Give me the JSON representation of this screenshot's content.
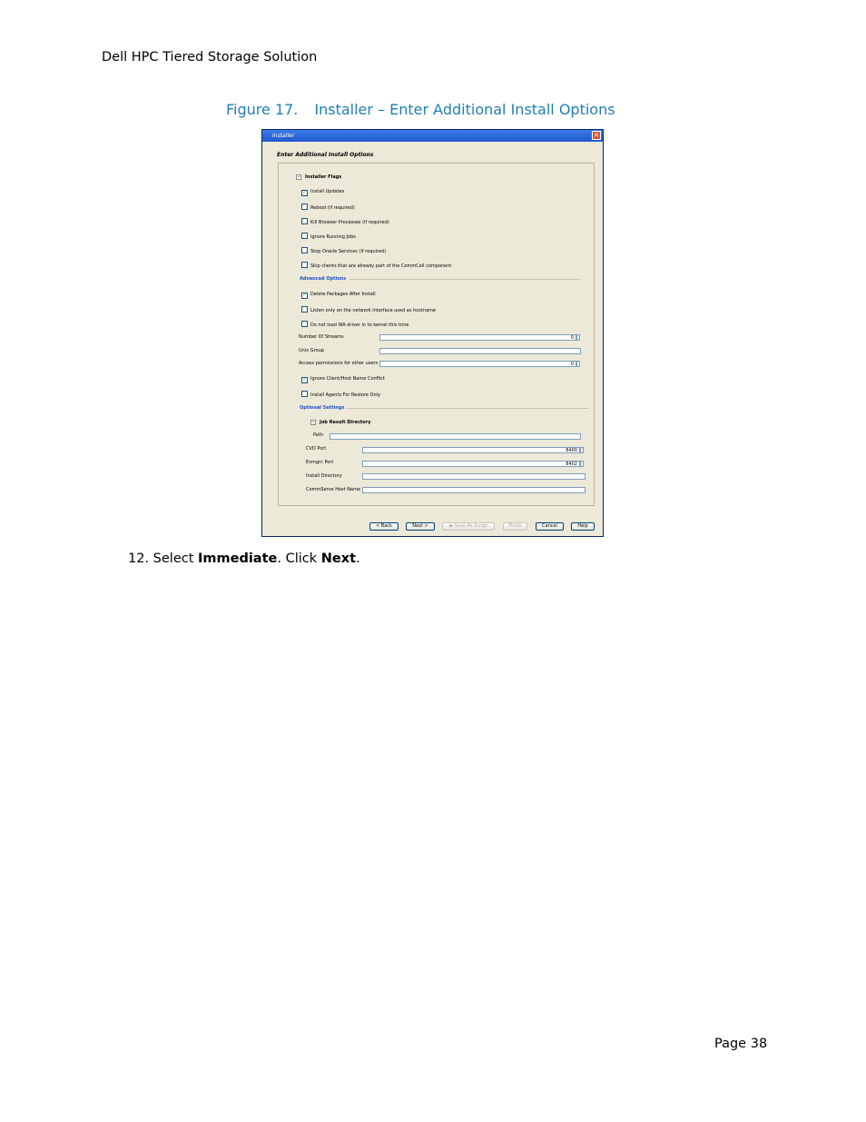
{
  "header": {
    "title": "Dell HPC Tiered Storage Solution"
  },
  "caption": {
    "number": "Figure 17.",
    "text": "Installer – Enter Additional Install Options"
  },
  "dialog": {
    "title": "Installer",
    "heading": "Enter Additional Install Options",
    "installer_flags": {
      "label": "Installer Flags",
      "items": [
        {
          "label": "Install Updates",
          "checked": true
        },
        {
          "label": "Reboot (if required)",
          "checked": false
        },
        {
          "label": "Kill Browser Processes (if required)",
          "checked": false
        },
        {
          "label": "Ignore Running Jobs",
          "checked": false
        },
        {
          "label": "Stop Oracle Services (if required)",
          "checked": false
        },
        {
          "label": "Skip clients that are already part of the CommCell component",
          "checked": false
        }
      ]
    },
    "advanced_options": {
      "label": "Advanced Options",
      "items": [
        {
          "label": "Delete Packages After Install",
          "checked": true
        },
        {
          "label": "Listen only on the network interface used as hostname",
          "checked": false
        },
        {
          "label": "Do not load WA driver in to kernel this time",
          "checked": false
        }
      ],
      "number_of_streams": {
        "label": "Number Of Streams",
        "value": "0"
      },
      "unix_group": {
        "label": "Unix Group",
        "value": ""
      },
      "access_permissions": {
        "label": "Access permissions for other users",
        "value": "0"
      },
      "items2": [
        {
          "label": "Ignore Client/Host Name Conflict",
          "checked": true
        },
        {
          "label": "Install Agents For Restore Only",
          "checked": false
        }
      ]
    },
    "optional_settings": {
      "label": "Optional Settings",
      "job_result_directory": {
        "label": "Job Result Directory",
        "path_label": "Path",
        "path_value": ""
      },
      "cvd_port": {
        "label": "CVD Port",
        "value": "8400"
      },
      "evmgrc_port": {
        "label": "Evmgrc Port",
        "value": "8402"
      },
      "install_directory": {
        "label": "Install Directory",
        "value": ""
      },
      "commserve_host_name": {
        "label": "CommServe Host Name",
        "value": ""
      }
    },
    "buttons": {
      "back": "< Back",
      "next": "Next >",
      "save_as_script": "Save As Script",
      "finish": "Finish",
      "cancel": "Cancel",
      "help": "Help"
    }
  },
  "step": {
    "number": "12.",
    "select": "Select",
    "immediate": "Immediate",
    "click": ". Click",
    "next": "Next",
    "end": "."
  },
  "footer": {
    "page": "Page 38"
  }
}
